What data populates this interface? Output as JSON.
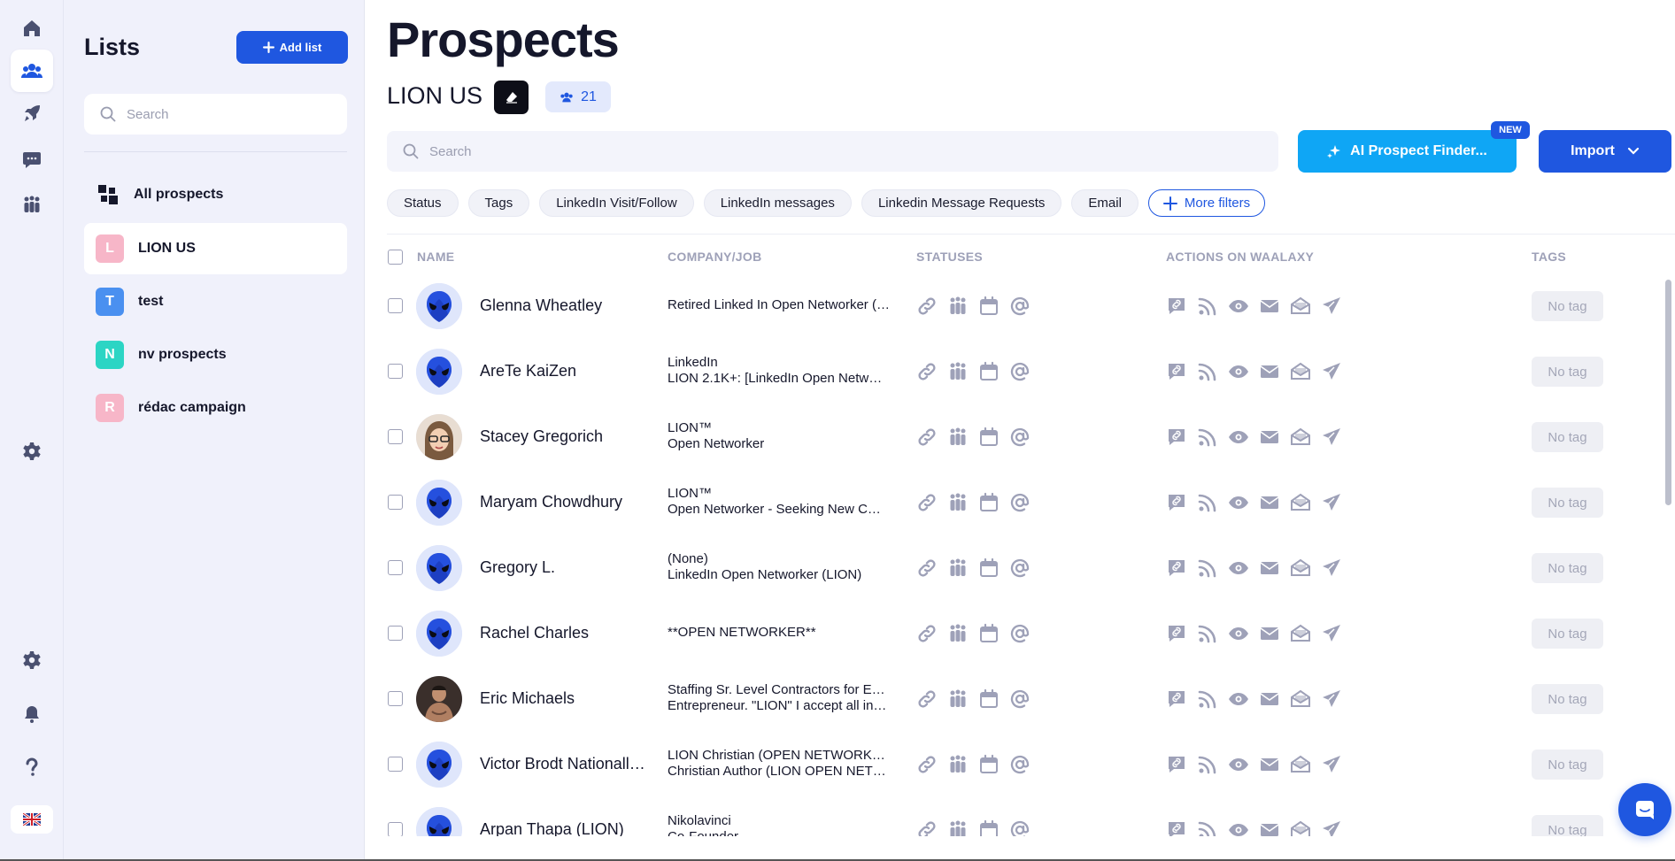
{
  "nav": {
    "items": [
      {
        "name": "home-nav",
        "icon": "home-icon"
      },
      {
        "name": "prospects-nav",
        "icon": "users-icon",
        "active": true
      },
      {
        "name": "campaigns-nav",
        "icon": "rocket-icon"
      },
      {
        "name": "inbox-nav",
        "icon": "chat-icon"
      },
      {
        "name": "team-nav",
        "icon": "team-icon"
      },
      {
        "name": "settings-nav",
        "icon": "gear-icon"
      },
      {
        "name": "account-settings-nav",
        "icon": "gear-icon"
      },
      {
        "name": "notifications-nav",
        "icon": "bell-icon"
      },
      {
        "name": "help-nav",
        "icon": "question-icon"
      }
    ],
    "language_icon": "uk-flag-icon"
  },
  "lists_panel": {
    "title": "Lists",
    "add_button": "Add list",
    "search_placeholder": "Search",
    "all_prospects": "All prospects",
    "items": [
      {
        "letter": "L",
        "label": "LION US",
        "color": "#f7b6c8",
        "active": true
      },
      {
        "letter": "T",
        "label": "test",
        "color": "#4a90f0"
      },
      {
        "letter": "N",
        "label": "nv prospects",
        "color": "#2cd5c4"
      },
      {
        "letter": "R",
        "label": "rédac campaign",
        "color": "#f7b6c8"
      }
    ]
  },
  "main": {
    "title": "Prospects",
    "list_name": "LION US",
    "prospect_count": "21",
    "search_placeholder": "Search",
    "ai_button": "AI Prospect Finder...",
    "new_badge": "NEW",
    "import_button": "Import",
    "filters": [
      "Status",
      "Tags",
      "LinkedIn Visit/Follow",
      "LinkedIn messages",
      "Linkedin Message Requests",
      "Email"
    ],
    "more_filters": "More filters"
  },
  "table": {
    "headers": {
      "name": "NAME",
      "company": "COMPANY/JOB",
      "statuses": "STATUSES",
      "actions": "ACTIONS ON WAALAXY",
      "tags": "TAGS"
    },
    "rows": [
      {
        "name": "Glenna Wheatley",
        "avatar": "alien",
        "lines": [
          "Retired Linked In Open Networker (…"
        ],
        "tag": "No tag"
      },
      {
        "name": "AreTe KaiZen",
        "avatar": "alien",
        "lines": [
          "LinkedIn",
          "LION 2.1K+: [LinkedIn Open Netw…"
        ],
        "tag": "No tag"
      },
      {
        "name": "Stacey Gregorich",
        "avatar": "photo-woman",
        "lines": [
          "LION™",
          "Open Networker"
        ],
        "tag": "No tag"
      },
      {
        "name": "Maryam Chowdhury",
        "avatar": "alien",
        "lines": [
          "LION™",
          "Open Networker - Seeking New C…"
        ],
        "tag": "No tag"
      },
      {
        "name": "Gregory L.",
        "avatar": "alien",
        "lines": [
          "(None)",
          "LinkedIn Open Networker (LION)"
        ],
        "tag": "No tag"
      },
      {
        "name": "Rachel Charles",
        "avatar": "alien",
        "lines": [
          "**OPEN NETWORKER**"
        ],
        "tag": "No tag"
      },
      {
        "name": "Eric Michaels",
        "avatar": "photo-man",
        "lines": [
          "Staffing Sr. Level Contractors for E…",
          "Entrepreneur. \"LION\" I accept all in…"
        ],
        "tag": "No tag"
      },
      {
        "name": "Victor Brodt Nationall…",
        "avatar": "alien",
        "lines": [
          "LION Christian (OPEN NETWORKER)",
          "Christian Author (LION OPEN NET…"
        ],
        "tag": "No tag"
      },
      {
        "name": "Arpan Thapa (LION)",
        "avatar": "alien",
        "lines": [
          "Nikolavinci",
          "Co-Founder"
        ],
        "tag": "No tag"
      }
    ],
    "status_icons": [
      "link-icon",
      "team-icon",
      "calendar-icon",
      "at-icon"
    ],
    "action_icons": [
      "linkedin-message-icon",
      "rss-follow-icon",
      "eye-visit-icon",
      "email-icon",
      "open-email-icon",
      "send-invite-icon"
    ]
  },
  "chat_icon": "chat-bubble-icon",
  "colors": {
    "primary": "#1f57e0",
    "ai_button": "#0fa6f5",
    "sidebar_bg": "#f0f1fb",
    "icon_gray": "#9ea1b8"
  }
}
